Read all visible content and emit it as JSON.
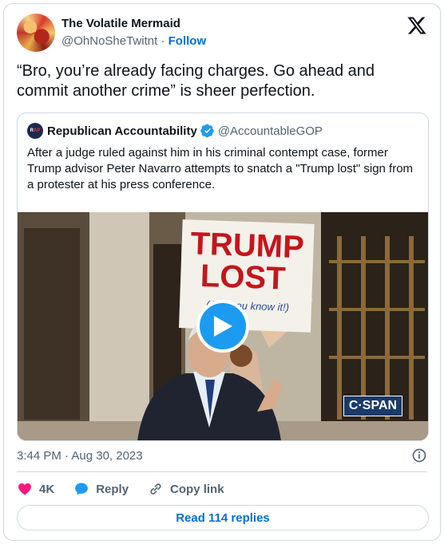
{
  "tweet": {
    "author_name": "The Volatile Mermaid",
    "author_handle": "@OhNoSheTwitnt",
    "separator": "·",
    "follow_label": "Follow",
    "text": "“Bro, you’re already facing charges. Go ahead and commit another crime” is sheer perfection.",
    "timestamp": "3:44 PM · Aug 30, 2023"
  },
  "quoted_tweet": {
    "avatar_text_left": "R",
    "avatar_text_right": "AP",
    "author_name": "Republican Accountability",
    "author_handle": "@AccountableGOP",
    "text": "After a judge ruled against him in his criminal contempt case, former Trump advisor Peter Navarro attempts to snatch a \"Trump lost\" sign from a protester at his press conference.",
    "media": {
      "sign_line1": "TRUMP",
      "sign_line2": "LOST",
      "sign_line3": "(And you know it!)",
      "watermark": "C·SPAN"
    }
  },
  "actions": {
    "like_count": "4K",
    "reply_label": "Reply",
    "copy_link_label": "Copy link"
  },
  "read_replies_label": "Read 114 replies",
  "colors": {
    "brand_blue": "#1d9bf0",
    "link_blue": "#006fd6",
    "like_pink": "#f91880",
    "muted_gray": "#536471",
    "border": "#cfd9de"
  },
  "icons": {
    "brand": "x-logo-icon",
    "verified": "verified-badge-icon",
    "play": "play-icon",
    "info": "info-icon",
    "like": "heart-icon",
    "reply": "reply-bubble-icon",
    "copy": "link-icon"
  }
}
